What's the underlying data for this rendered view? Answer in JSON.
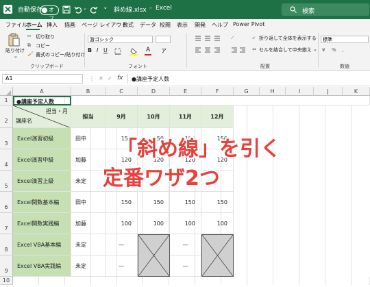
{
  "titlebar": {
    "autosave_label": "自動保存",
    "autosave_state": "オフ",
    "filename": "斜め線.xlsx",
    "separator": "-",
    "app_name": "Excel",
    "search_placeholder": "検索"
  },
  "menu": {
    "items": [
      "ファイル",
      "ホーム",
      "挿入",
      "描画",
      "ページ レイアウト",
      "数式",
      "データ",
      "校閲",
      "表示",
      "開発",
      "ヘルプ",
      "Power Pivot"
    ],
    "active_index": 1
  },
  "ribbon": {
    "paste_label": "貼り付け",
    "cut_label": "切り取り",
    "copy_label": "コピー",
    "format_painter_label": "書式のコピー/貼り付け",
    "clipboard_group": "クリップボード",
    "font_name": "游ゴシック",
    "font_group": "フォント",
    "wrap_text_label": "折り返して全体を表示する",
    "merge_center_label": "セルを結合して中央揃え",
    "alignment_group": "配置",
    "number_format": "標準",
    "number_group": "数値"
  },
  "formula_bar": {
    "name_box": "A1",
    "fx_label": "fx",
    "content": "●講座予定人数"
  },
  "sheet": {
    "columns": [
      "A",
      "B",
      "C",
      "D",
      "E",
      "F",
      "G",
      "H",
      "I",
      "J",
      "K"
    ],
    "rows": [
      "1",
      "2",
      "3",
      "4",
      "5",
      "6",
      "7",
      "8",
      "9",
      "10"
    ],
    "title": "●講座予定人数",
    "header_diag_top": "担当・月",
    "header_diag_bottom": "講座名",
    "header_tanto": "担当",
    "months": [
      "9月",
      "10月",
      "11月",
      "12月"
    ],
    "data": [
      {
        "course": "Excel演習初級",
        "person": "田中",
        "values": [
          "150",
          "150",
          "150",
          "150"
        ]
      },
      {
        "course": "Excel演習中級",
        "person": "加藤",
        "values": [
          "120",
          "120",
          "120",
          "120"
        ]
      },
      {
        "course": "Excel演習上級",
        "person": "未定",
        "values": [
          "",
          "",
          "",
          ""
        ]
      },
      {
        "course": "Excel関数基本編",
        "person": "田中",
        "values": [
          "150",
          "150",
          "150",
          "150"
        ]
      },
      {
        "course": "Excel関数実践編",
        "person": "加藤",
        "values": [
          "100",
          "100",
          "100",
          "100"
        ]
      },
      {
        "course": "Excel VBA基本編",
        "person": "未定",
        "values": [
          "—",
          "",
          "—",
          ""
        ]
      },
      {
        "course": "Excel VBA実践編",
        "person": "未定",
        "values": [
          "—",
          "",
          "—",
          ""
        ]
      }
    ]
  },
  "overlay": {
    "line1": "「斜め線」を引く",
    "line2": "定番ワザ2つ"
  },
  "colors": {
    "excel_green": "#1e7145",
    "header_green": "#e2efda",
    "label_green": "#c6e0b4",
    "overlay_red": "#e8403b"
  }
}
